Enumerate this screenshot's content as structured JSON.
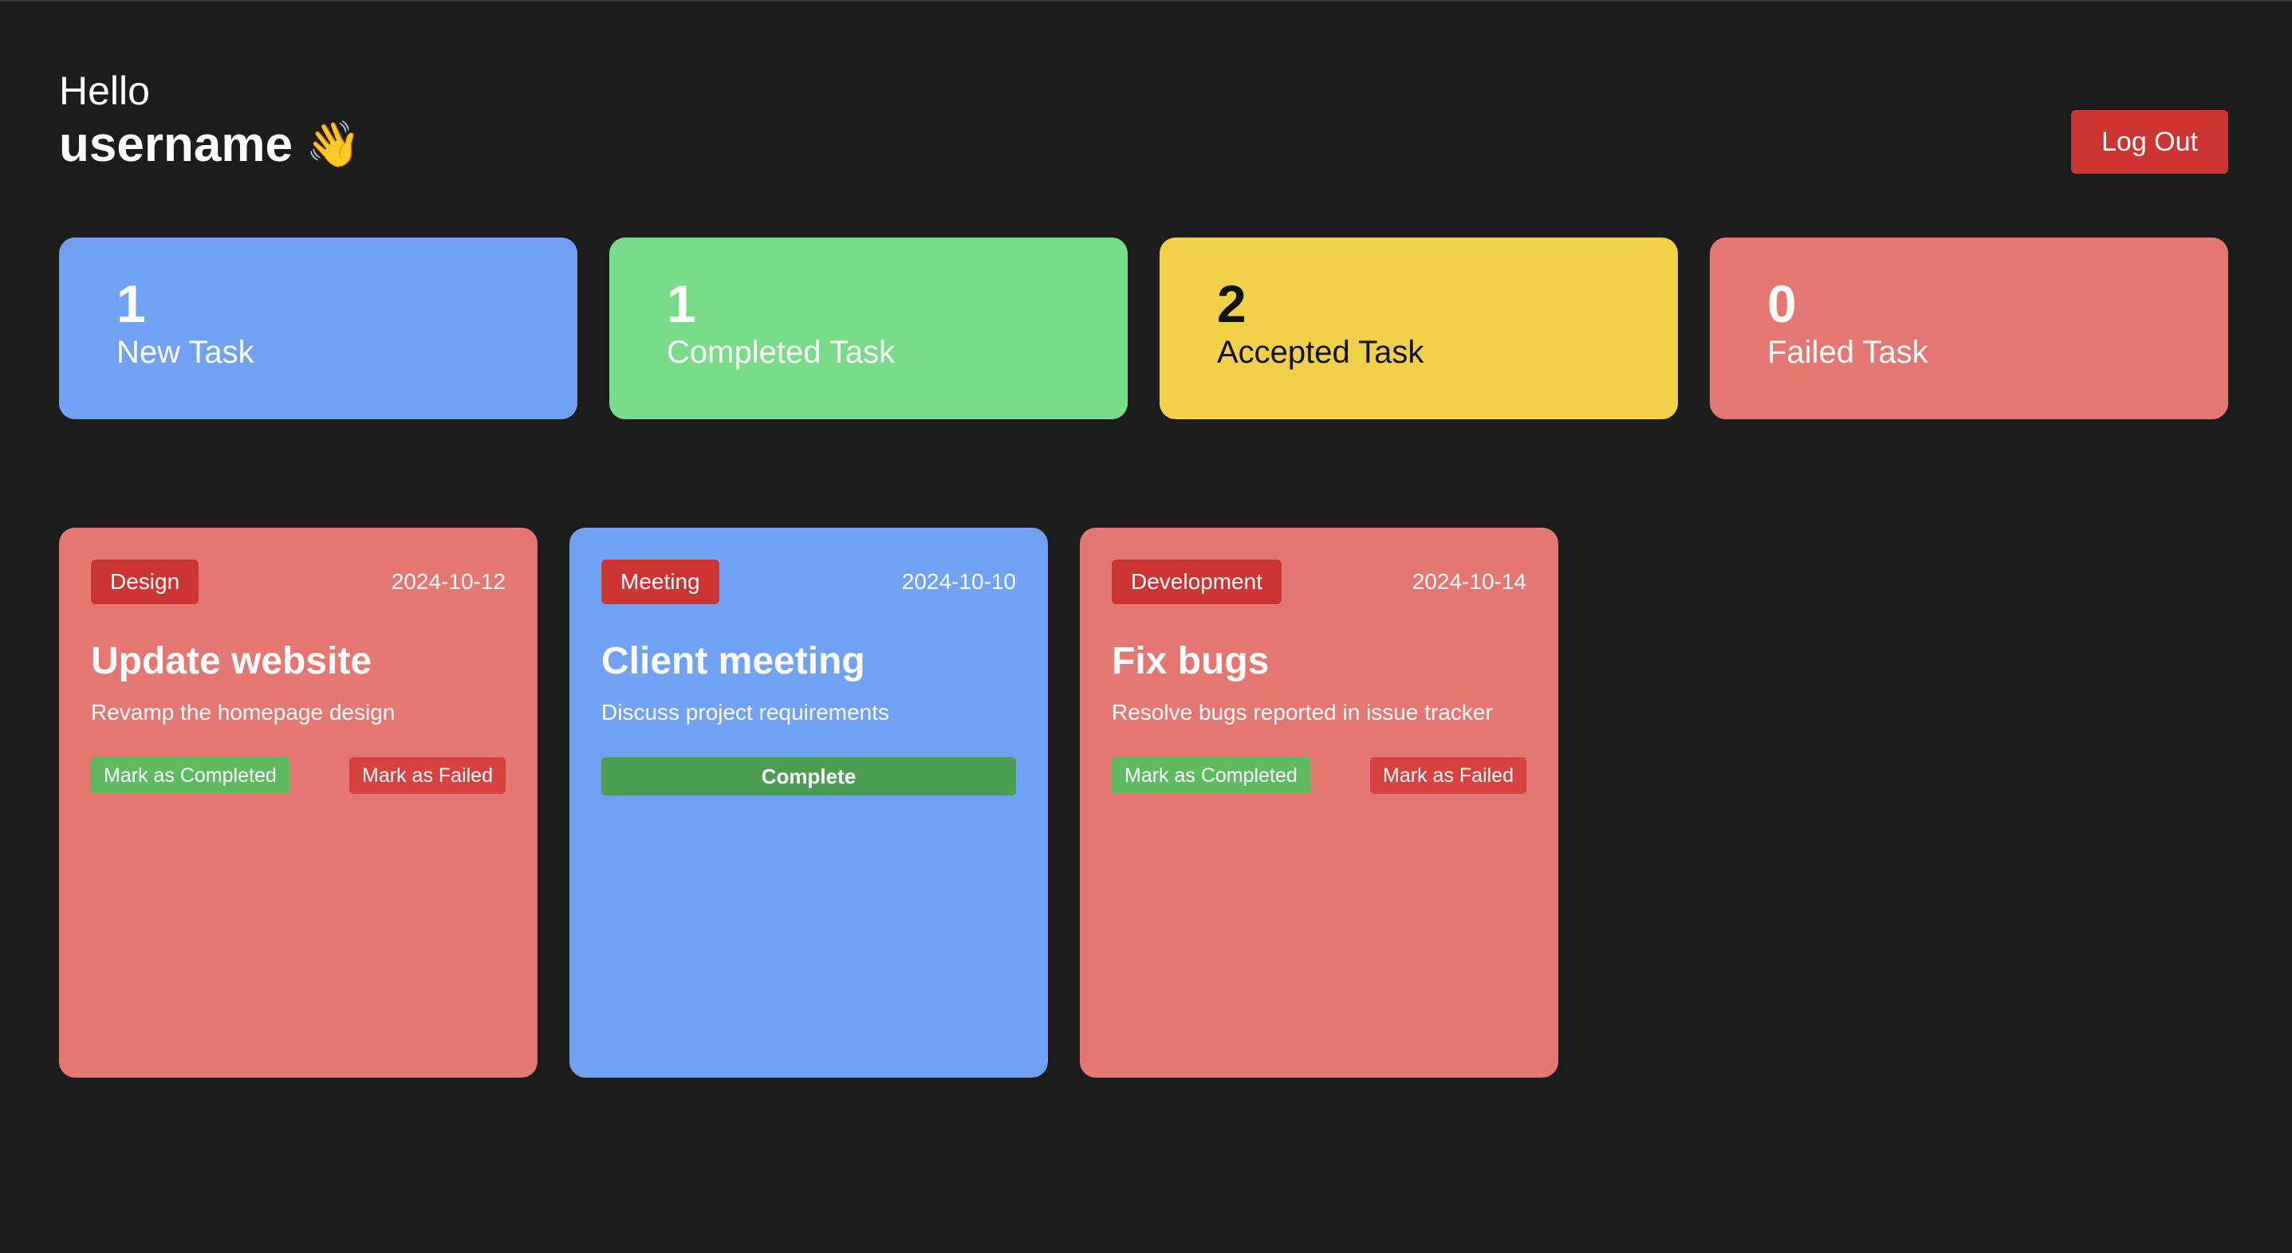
{
  "header": {
    "greeting": "Hello",
    "username": "username",
    "wave_emoji": "👋",
    "logout_label": "Log Out"
  },
  "stats": [
    {
      "count": "1",
      "label": "New Task",
      "color": "#70a2f4"
    },
    {
      "count": "1",
      "label": "Completed Task",
      "color": "#78dc89"
    },
    {
      "count": "2",
      "label": "Accepted Task",
      "color": "#f3d049"
    },
    {
      "count": "0",
      "label": "Failed Task",
      "color": "#e57773"
    }
  ],
  "tasks": [
    {
      "category": "Design",
      "date": "2024-10-12",
      "title": "Update website",
      "description": "Revamp the homepage design",
      "color": "#e57773",
      "complete_label": "Mark as Completed",
      "failed_label": "Mark as Failed"
    },
    {
      "category": "Meeting",
      "date": "2024-10-10",
      "title": "Client meeting",
      "description": "Discuss project requirements",
      "color": "#70a2f4",
      "action_label": "Complete"
    },
    {
      "category": "Development",
      "date": "2024-10-14",
      "title": "Fix bugs",
      "description": "Resolve bugs reported in issue tracker",
      "color": "#e57773",
      "complete_label": "Mark as Completed",
      "failed_label": "Mark as Failed"
    }
  ]
}
